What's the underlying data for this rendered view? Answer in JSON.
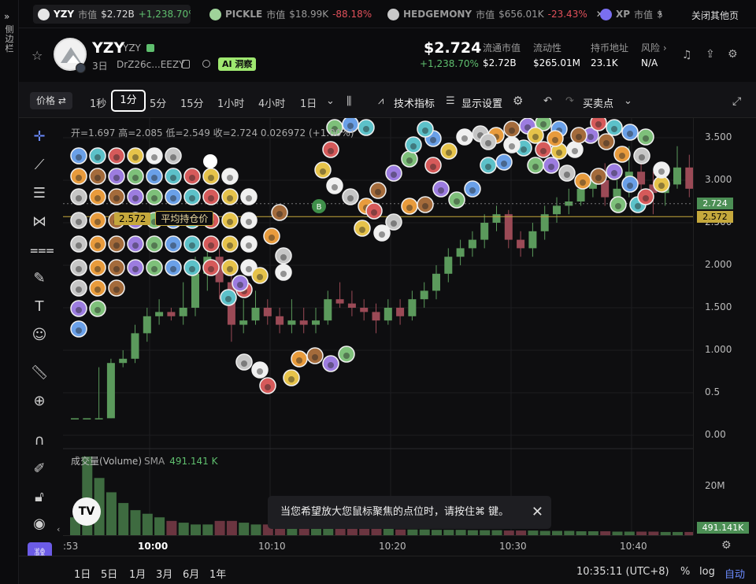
{
  "sidebar": {
    "label": "侧边栏"
  },
  "tabs": [
    {
      "symbol": "YZY",
      "mc_label": "市值",
      "mc": "$2.72B",
      "change": "+1,238.70%",
      "dir": "up",
      "icon_color": "#e6e6e6"
    },
    {
      "symbol": "PICKLE",
      "mc_label": "市值",
      "mc": "$18.99K",
      "change": "-88.18%",
      "dir": "down",
      "icon_color": "#9fd39a"
    },
    {
      "symbol": "HEDGEMONY",
      "mc_label": "市值",
      "mc": "$656.01K",
      "change": "-23.43%",
      "dir": "down",
      "icon_color": "#c9c9c9"
    },
    {
      "symbol": "XP",
      "mc_label": "市值",
      "mc": "$",
      "change": "",
      "dir": "up",
      "icon_color": "#7a6ff0"
    }
  ],
  "close_all": "关闭其他页",
  "token": {
    "name": "YZY",
    "ticker": "YZY",
    "age": "3日",
    "address": "DrZ26c...EEZY",
    "ai_label": "AI 洞察",
    "price": "$2.724",
    "change": "+1,238.70%"
  },
  "stats": [
    {
      "label": "流通市值",
      "value": "$2.72B"
    },
    {
      "label": "流动性",
      "value": "$265.01M"
    },
    {
      "label": "持币地址",
      "value": "23.1K"
    },
    {
      "label": "风险 ›",
      "value": "N/A"
    }
  ],
  "toolbar": {
    "price_label": "价格 ⇄",
    "intervals": [
      "1秒",
      "1分",
      "5分",
      "15分",
      "1小时",
      "4小时",
      "1日"
    ],
    "active_interval": "1分",
    "indicators": "技术指标",
    "display_settings": "显示设置",
    "buy_sell": "买卖点"
  },
  "chart": {
    "ohlc": "开=1.697  高=2.085  低=2.549  收=2.724  0.026972 (+1.00%)",
    "avg_price_value": "2.572",
    "avg_price_label": "平均持仓价",
    "volume_label": "成交量(Volume)",
    "sma_label": "SMA",
    "volume_value": "491.141 K",
    "current_price_tag": "2.724",
    "avg_price_tag": "2.572",
    "volume_tag": "491.141K",
    "volume_axis": "20M",
    "toast": "当您希望放大您鼠标聚焦的点位时，请按住⌘ 键。",
    "logo": "TV"
  },
  "chart_data": {
    "type": "bar",
    "title": "",
    "y_ticks": [
      "3.500",
      "3.000",
      "2.500",
      "2.000",
      "1.500",
      "1.000",
      "0.5",
      "0.00"
    ],
    "x_ticks": [
      ":53",
      "10:00",
      "10:10",
      "10:20",
      "10:30",
      "10:40"
    ],
    "ylim": [
      0,
      3.6
    ],
    "candles": [
      [
        0.2,
        0.2,
        0.2,
        0.2
      ],
      [
        0.2,
        0.2,
        0.2,
        0.2
      ],
      [
        0.2,
        0.2,
        0.8,
        0.2
      ],
      [
        0.2,
        0.85,
        0.9,
        0.2
      ],
      [
        0.85,
        0.9,
        1.0,
        0.8
      ],
      [
        0.9,
        1.2,
        1.3,
        0.85
      ],
      [
        1.2,
        1.4,
        1.5,
        1.1
      ],
      [
        1.4,
        1.45,
        1.6,
        1.3
      ],
      [
        1.45,
        1.4,
        1.5,
        1.35
      ],
      [
        1.4,
        1.5,
        1.8,
        1.3
      ],
      [
        1.5,
        1.9,
        2.1,
        1.4
      ],
      [
        1.9,
        2.1,
        2.2,
        1.7
      ],
      [
        2.1,
        1.8,
        2.2,
        1.6
      ],
      [
        1.8,
        1.3,
        1.9,
        1.1
      ],
      [
        1.3,
        1.35,
        1.6,
        1.2
      ],
      [
        1.35,
        1.5,
        1.7,
        1.3
      ],
      [
        1.5,
        1.4,
        1.6,
        1.3
      ],
      [
        1.4,
        1.3,
        1.5,
        1.2
      ],
      [
        1.3,
        1.35,
        1.6,
        1.2
      ],
      [
        1.35,
        1.3,
        1.5,
        1.2
      ],
      [
        1.3,
        1.35,
        1.5,
        1.2
      ],
      [
        1.35,
        1.6,
        1.7,
        1.3
      ],
      [
        1.6,
        1.55,
        1.8,
        1.5
      ],
      [
        1.55,
        1.5,
        1.7,
        1.4
      ],
      [
        1.5,
        1.45,
        1.6,
        1.35
      ],
      [
        1.45,
        1.35,
        1.55,
        1.2
      ],
      [
        1.35,
        1.5,
        1.6,
        1.3
      ],
      [
        1.5,
        1.4,
        1.6,
        1.3
      ],
      [
        1.4,
        1.6,
        1.7,
        1.35
      ],
      [
        1.6,
        1.7,
        1.8,
        1.5
      ],
      [
        1.7,
        1.9,
        2.0,
        1.6
      ],
      [
        1.9,
        2.1,
        2.2,
        1.8
      ],
      [
        2.1,
        2.2,
        2.3,
        2.0
      ],
      [
        2.2,
        2.3,
        2.4,
        2.1
      ],
      [
        2.3,
        2.5,
        2.6,
        2.2
      ],
      [
        2.5,
        2.6,
        2.7,
        2.4
      ],
      [
        2.6,
        2.3,
        2.65,
        2.2
      ],
      [
        2.3,
        2.2,
        2.4,
        2.1
      ],
      [
        2.2,
        2.4,
        2.5,
        2.1
      ],
      [
        2.4,
        2.6,
        2.7,
        2.3
      ],
      [
        2.6,
        2.7,
        2.8,
        2.5
      ],
      [
        2.7,
        2.75,
        2.9,
        2.6
      ],
      [
        2.75,
        2.9,
        3.0,
        2.7
      ],
      [
        2.9,
        3.0,
        3.1,
        2.8
      ],
      [
        3.0,
        2.8,
        3.2,
        2.7
      ],
      [
        2.8,
        2.9,
        3.0,
        2.7
      ],
      [
        2.9,
        3.1,
        3.4,
        2.8
      ],
      [
        3.1,
        2.95,
        3.3,
        2.8
      ],
      [
        2.95,
        2.85,
        3.1,
        2.6
      ],
      [
        2.85,
        2.95,
        3.2,
        2.7
      ],
      [
        2.95,
        3.15,
        3.4,
        2.9
      ],
      [
        3.15,
        2.9,
        3.3,
        2.8
      ],
      [
        2.9,
        2.75,
        3.0,
        2.5
      ],
      [
        2.75,
        2.7,
        2.9,
        2.4
      ],
      [
        2.7,
        2.75,
        2.9,
        2.4
      ],
      [
        2.75,
        2.72,
        3.0,
        2.6
      ]
    ],
    "volumes": [
      5,
      22,
      16,
      12,
      9,
      7,
      6,
      5,
      4,
      3.5,
      3,
      3,
      4,
      4,
      3.5,
      3,
      3,
      2.5,
      2.5,
      2.5,
      2,
      2,
      2,
      2,
      1.8,
      1.8,
      1.8,
      1.6,
      1.6,
      1.6,
      1.5,
      1.5,
      1.5,
      1.4,
      1.4,
      1.4,
      1.3,
      1.3,
      1.3,
      1.2,
      1.2,
      1.2,
      1.1,
      1.1,
      1.1,
      1,
      1,
      1,
      1,
      0.9,
      0.9,
      0.9,
      0.8,
      0.8,
      0.8,
      0.7
    ],
    "current_price": 2.724,
    "avg_price": 2.572
  },
  "xaxis": {
    "labels": [
      ":53",
      "10:00",
      "10:10",
      "10:20",
      "10:30",
      "10:40"
    ]
  },
  "bottom": {
    "ranges": [
      "1日",
      "5日",
      "1月",
      "3月",
      "6月",
      "1年"
    ],
    "clock": "10:35:11 (UTC+8)",
    "percent": "%",
    "log": "log",
    "auto": "自动"
  }
}
